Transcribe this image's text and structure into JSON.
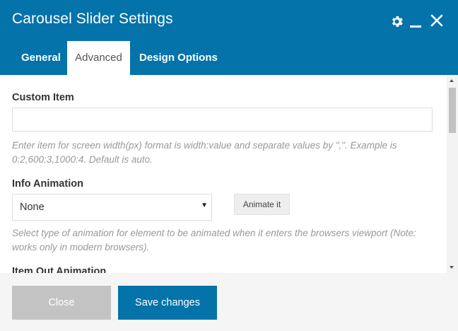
{
  "dialog": {
    "title": "Carousel Slider Settings",
    "accent_color": "#0473aa"
  },
  "tabs": [
    {
      "label": "General",
      "active": false
    },
    {
      "label": "Advanced",
      "active": true
    },
    {
      "label": "Design Options",
      "active": false
    }
  ],
  "fields": {
    "custom_item": {
      "label": "Custom Item",
      "value": "",
      "help": "Enter item for screen width(px) format is width:value and separate values by \",\". Example is 0:2,600:3,1000:4. Default is auto."
    },
    "info_animation": {
      "label": "Info Animation",
      "selected": "None",
      "animate_button": "Animate it",
      "help": "Select type of animation for element to be animated when it enters the browsers viewport (Note: works only in modern browsers)."
    },
    "item_out_animation": {
      "label": "Item Out Animation"
    }
  },
  "footer": {
    "close_label": "Close",
    "save_label": "Save changes"
  },
  "icons": [
    "gear-icon",
    "minimize-icon",
    "close-icon",
    "chevron-down-icon"
  ]
}
